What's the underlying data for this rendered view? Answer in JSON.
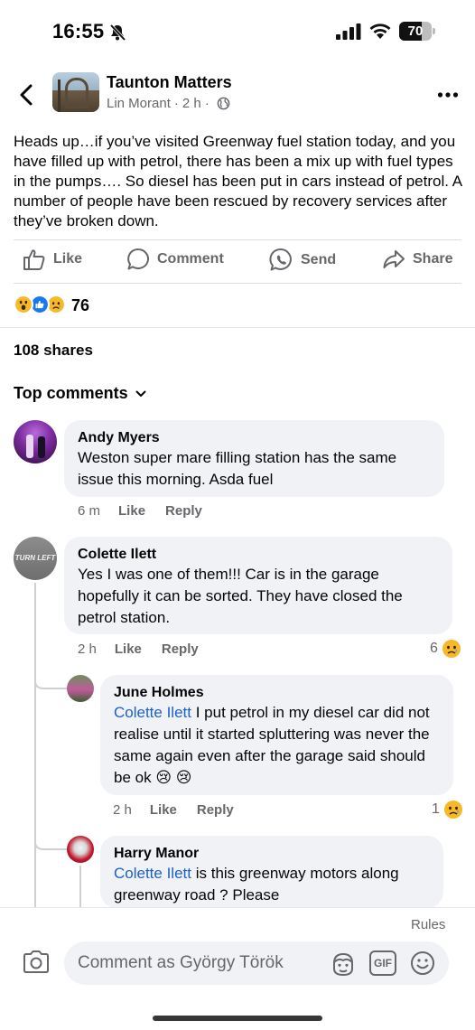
{
  "status_bar": {
    "time": "16:55",
    "battery": "70",
    "battery_level": 0.7
  },
  "post": {
    "group_name": "Taunton Matters",
    "author": "Lin Morant",
    "sep": "·",
    "time": "2 h",
    "text": "Heads up…if you’ve visited Greenway fuel station today, and you have filled up with petrol, there has been a mix up with fuel types in the pumps…. So diesel has been put in cars instead of petrol.  A number of people have been rescued by recovery services after they’ve broken down."
  },
  "actions": {
    "like": "Like",
    "comment": "Comment",
    "send": "Send",
    "share": "Share"
  },
  "reactions": {
    "count": "76",
    "types": [
      "wow",
      "like",
      "sad"
    ]
  },
  "shares": "108 shares",
  "comments_header": "Top comments",
  "comments": [
    {
      "name": "Andy Myers",
      "text": "Weston super mare filling station has the same issue this morning. Asda fuel",
      "time": "6 m",
      "like": "Like",
      "reply": "Reply"
    },
    {
      "name": "Colette Ilett",
      "text": "Yes I was one of them!!! Car is in the garage hopefully it can be sorted. They have closed the petrol station.",
      "time": "2 h",
      "like": "Like",
      "reply": "Reply",
      "reaction_count": "6",
      "avatar_text": "TURN LEFT",
      "replies": [
        {
          "name": "June Holmes",
          "mention": "Colette Ilett",
          "text": " I put petrol in my diesel car did not realise until it started spluttering was never the same again even after the garage said should be ok",
          "emoji": "😢 😢",
          "time": "2 h",
          "like": "Like",
          "reply": "Reply",
          "reaction_count": "1"
        },
        {
          "name": "Harry Manor",
          "mention": "Colette Ilett",
          "text": " is this greenway motors along greenway road ? Please"
        }
      ]
    }
  ],
  "composer": {
    "rules": "Rules",
    "placeholder": "Comment as György Török",
    "gif": "GIF"
  }
}
